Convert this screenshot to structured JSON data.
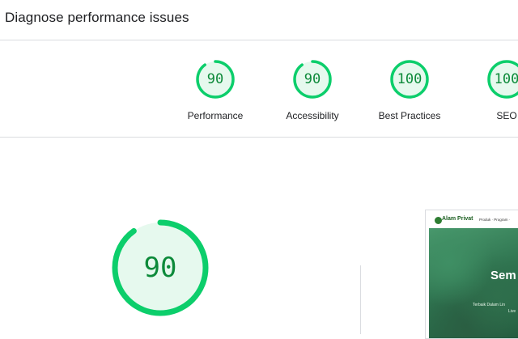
{
  "header": {
    "title": "Diagnose performance issues"
  },
  "categories": [
    {
      "score": "90",
      "fraction": 0.9,
      "label": "Performance"
    },
    {
      "score": "90",
      "fraction": 0.9,
      "label": "Accessibility"
    },
    {
      "score": "100",
      "fraction": 1.0,
      "label": "Best Practices"
    },
    {
      "score": "100",
      "fraction": 1.0,
      "label": "SEO"
    }
  ],
  "main_score": {
    "score": "90",
    "fraction": 0.9
  },
  "thumbnail": {
    "brand": "Alam Privat",
    "menu": "Produk · Program ·",
    "hero_title": "Sem",
    "hero_sub": "Terbaik Dalam Lin",
    "hero_sub2": "Live"
  },
  "colors": {
    "pass_stroke": "#0cce6b",
    "pass_fill": "#e6f9ee",
    "pass_text": "#0d8a3a",
    "track": "#e6f9ee"
  }
}
